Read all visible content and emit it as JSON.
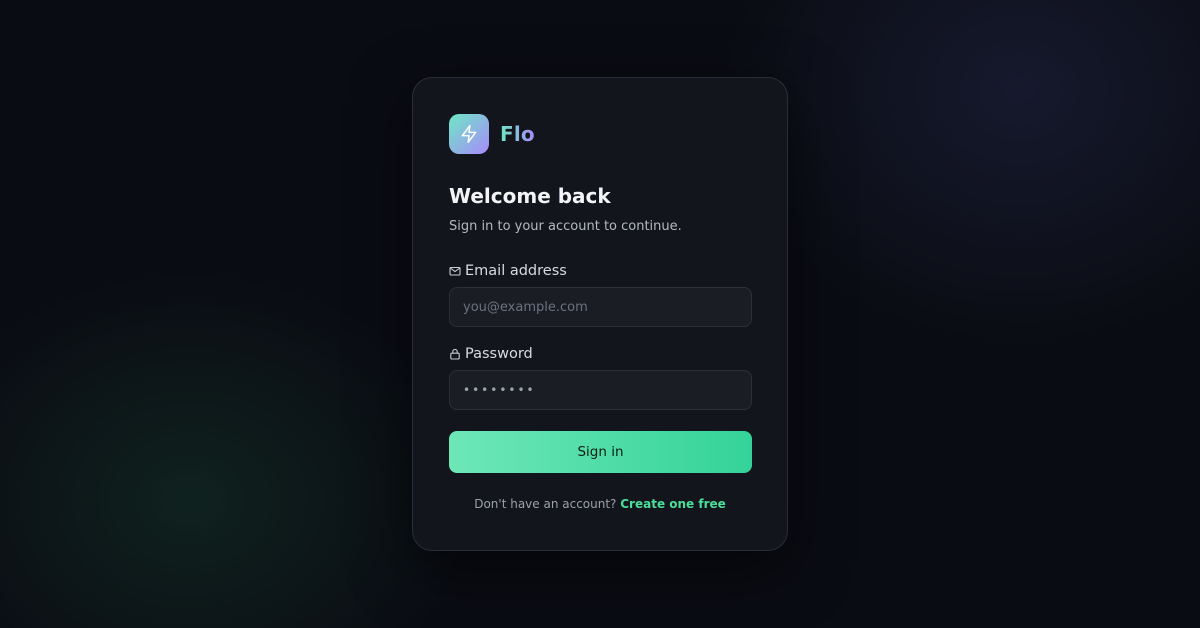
{
  "brand": {
    "name": "Flo",
    "logo_icon": "lightning-bolt-icon",
    "gradient": [
      "#6ee7c5",
      "#a78bfa"
    ]
  },
  "heading": {
    "title": "Welcome back",
    "subtitle": "Sign in to your account to continue."
  },
  "form": {
    "email": {
      "label": "Email address",
      "icon": "mail-icon",
      "value": "",
      "placeholder": "you@example.com"
    },
    "password": {
      "label": "Password",
      "icon": "lock-icon",
      "value": "••••••••"
    },
    "submit_label": "Sign in"
  },
  "footer": {
    "prompt": "Don't have an account?",
    "link": "Create one free"
  },
  "colors": {
    "background": "#0a0c13",
    "card": "#13151c",
    "accent": "#34d399",
    "link": "#4ade9a"
  }
}
